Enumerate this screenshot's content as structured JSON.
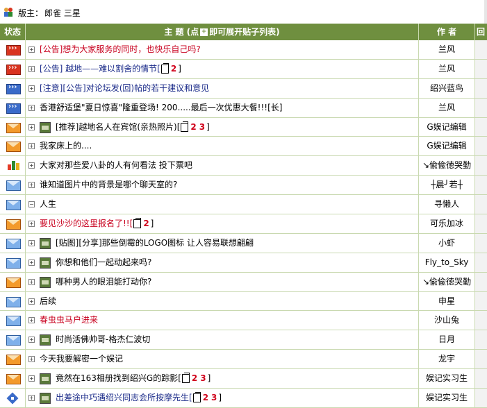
{
  "moderator": {
    "label": "版主：",
    "names": "郎雀  三星"
  },
  "header": {
    "status": "状态",
    "topic_prefix": "主 题 (点",
    "topic_suffix": "即可展开贴子列表)",
    "author": "作 者",
    "extra": "回"
  },
  "colors": {
    "header_bg": "#6f8f3f",
    "grid": "#c9d9b0",
    "red_text": "#c8001e",
    "navy_text": "#1c2c8a",
    "page_num": "#d0001a"
  },
  "rows": [
    {
      "icon": "announcement-red-icon",
      "expander": "+",
      "title": "[公告]想为大家服务的同时，也快乐自己吗?",
      "color": "red",
      "author": "兰风"
    },
    {
      "icon": "announcement-red-icon",
      "expander": "+",
      "title": "[公告] 越地——难以割舍的情节[",
      "pages": [
        "2"
      ],
      "pager_end": "]",
      "color": "navy",
      "author": "兰风"
    },
    {
      "icon": "pinned-blue-icon",
      "expander": "+",
      "title": "[注意][公告]对论坛发(回)帖的若干建议和意见",
      "color": "navy",
      "author": "绍兴蓝鸟"
    },
    {
      "icon": "pinned-blue-icon",
      "expander": "+",
      "title": "香港舒适堡\"夏日惊喜\"隆重登场! 200.....最后一次优惠大餐!!![长]",
      "color": "black",
      "author": "兰风"
    },
    {
      "icon": "hot-envelope-icon",
      "expander": "+",
      "jpg": true,
      "title": "[推荐]越地名人在宾馆(亲热照片)[",
      "pages": [
        "2",
        "3"
      ],
      "pager_end": "]",
      "color": "black",
      "author": "G娱记编辑"
    },
    {
      "icon": "hot-envelope-icon",
      "expander": "+",
      "title": "我家床上的....",
      "color": "black",
      "author": "G娱记编辑"
    },
    {
      "icon": "poll-icon",
      "expander": "+",
      "title": "大家对那些爱八卦的人有何看法  投下票吧",
      "color": "black",
      "author": "↘偸偸徳哭勤"
    },
    {
      "icon": "envelope-icon",
      "expander": "+",
      "title": "谁知道图片中的背景是哪个聊天室的?",
      "color": "black",
      "author": "┼晨╯若┼"
    },
    {
      "icon": "envelope-icon",
      "expander": "−",
      "title": "人生",
      "color": "black",
      "author": "寻懒人"
    },
    {
      "icon": "hot-envelope-icon",
      "expander": "+",
      "title": "要见沙沙的这里报名了!![",
      "pages": [
        "2"
      ],
      "pager_end": "]",
      "color": "red",
      "author": "可乐加冰"
    },
    {
      "icon": "envelope-icon",
      "expander": "+",
      "jpg": true,
      "title": "[贴图][分享]那些倒霉的LOGO图标 让人容易联想翩翩",
      "color": "black",
      "author": "小虾"
    },
    {
      "icon": "envelope-icon",
      "expander": "+",
      "jpg": true,
      "title": "你想和他们一起动起来吗?",
      "color": "black",
      "author": "Fly_to_Sky"
    },
    {
      "icon": "hot-envelope-icon",
      "expander": "+",
      "jpg": true,
      "title": "哪种男人的眼泪能打动你?",
      "color": "black",
      "author": "↘偸偸徳哭勤"
    },
    {
      "icon": "envelope-icon",
      "expander": "+",
      "title": "后续",
      "color": "black",
      "author": "申星"
    },
    {
      "icon": "envelope-icon",
      "expander": "+",
      "title": "春虫虫马户进来",
      "color": "red",
      "author": "沙山兔"
    },
    {
      "icon": "envelope-icon",
      "expander": "+",
      "jpg": true,
      "title": "时尚活佛帅哥-格杰仁波切",
      "color": "black",
      "author": "日月"
    },
    {
      "icon": "hot-envelope-icon",
      "expander": "+",
      "title": "今天我要解密一个娱记",
      "color": "black",
      "author": "龙宇"
    },
    {
      "icon": "hot-envelope-icon",
      "expander": "+",
      "jpg": true,
      "title": "竟然在163相册找到绍兴G的踪影[",
      "pages": [
        "2",
        "3"
      ],
      "pager_end": "]",
      "color": "black",
      "author": "娱记实习生"
    },
    {
      "icon": "stacked-topic-icon",
      "expander": "+",
      "jpg": true,
      "title": "出差途中巧遇绍兴同志会所按摩先生[",
      "pages": [
        "2",
        "3"
      ],
      "pager_end": "]",
      "color": "navy",
      "author": "娱记实习生"
    }
  ]
}
